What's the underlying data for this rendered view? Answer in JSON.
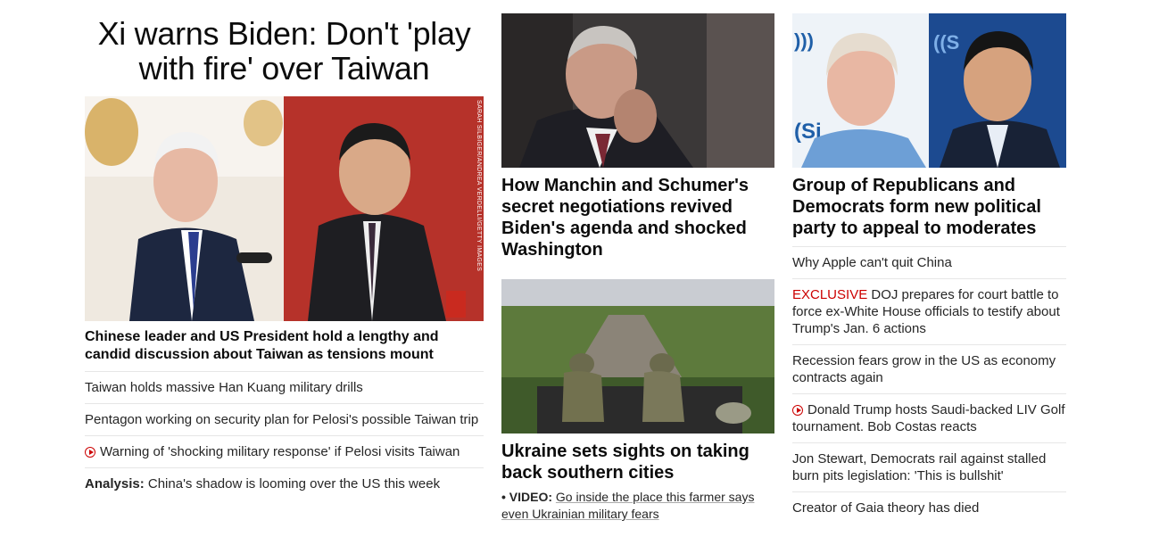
{
  "colors": {
    "accent_red": "#cc0000",
    "text": "#0c0c0c",
    "divider": "#e6e6e6"
  },
  "lead": {
    "headline": "Xi warns Biden: Don't 'play with fire' over Taiwan",
    "image_credit": "SARAH SILBIGER/ANDREA VERDELLI/GETTY IMAGES",
    "summary": "Chinese leader and US President hold a lengthy and candid discussion about Taiwan as tensions mount",
    "related": [
      {
        "text": "Taiwan holds massive Han Kuang military drills"
      },
      {
        "text": "Pentagon working on security plan for Pelosi's possible Taiwan trip"
      },
      {
        "icon": "play-video-icon",
        "text": "Warning of 'shocking military response' if Pelosi visits Taiwan"
      },
      {
        "prefix": "Analysis:",
        "text": "China's shadow is looming over the US this week"
      }
    ]
  },
  "middle": {
    "story1": {
      "title": "How Manchin and Schumer's secret negotiations revived Biden's agenda and shocked Washington"
    },
    "story2": {
      "title": "Ukraine sets sights on taking back southern cities",
      "video_prefix": "• VIDEO:",
      "video_text": "Go inside the place this farmer says even Ukrainian military fears"
    }
  },
  "right": {
    "story1": {
      "title": "Group of Republicans and Democrats form new political party to appeal to moderates"
    },
    "links": [
      {
        "text": "Why Apple can't quit China"
      },
      {
        "tag": "EXCLUSIVE",
        "text": "DOJ prepares for court battle to force ex-White House officials to testify about Trump's Jan. 6 actions"
      },
      {
        "text": "Recession fears grow in the US as economy contracts again"
      },
      {
        "icon": "play-video-icon",
        "text": "Donald Trump hosts Saudi-backed LIV Golf tournament. Bob Costas reacts"
      },
      {
        "text": "Jon Stewart, Democrats rail against stalled burn pits legislation: 'This is bullshit'"
      },
      {
        "text": "Creator of Gaia theory has died"
      }
    ]
  }
}
